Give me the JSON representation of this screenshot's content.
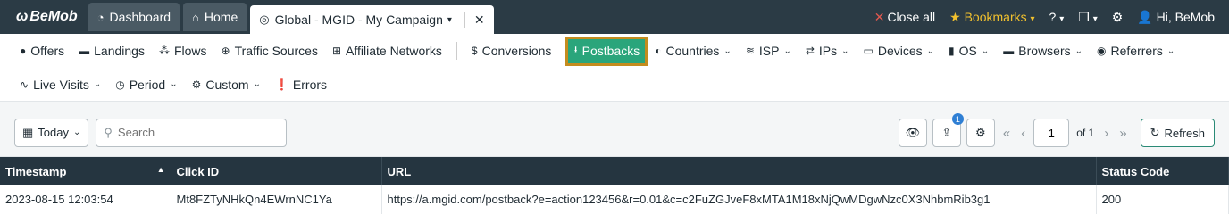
{
  "topbar": {
    "logo": "BeMob",
    "tabs": [
      {
        "label": "Dashboard",
        "icon": "dashboard-icon"
      },
      {
        "label": "Home",
        "icon": "home-icon"
      },
      {
        "label": "Global - MGID - My Campaign",
        "icon": "globe-icon",
        "active": true
      }
    ],
    "close_all": "Close all",
    "bookmarks": "Bookmarks",
    "user": "Hi, BeMob"
  },
  "nav": {
    "row1": [
      {
        "label": "Offers",
        "icon": "dollar-circle-icon"
      },
      {
        "label": "Landings",
        "icon": "window-icon"
      },
      {
        "label": "Flows",
        "icon": "sitemap-icon"
      },
      {
        "label": "Traffic Sources",
        "icon": "globe-icon"
      },
      {
        "label": "Affiliate Networks",
        "icon": "network-icon"
      },
      {
        "label": "Conversions",
        "icon": "dollar-icon"
      },
      {
        "label": "Postbacks",
        "icon": "download-icon",
        "highlighted": true
      },
      {
        "label": "Countries",
        "icon": "globe-icon",
        "dropdown": true
      },
      {
        "label": "ISP",
        "icon": "wifi-icon",
        "dropdown": true
      },
      {
        "label": "IPs",
        "icon": "exchange-icon",
        "dropdown": true
      },
      {
        "label": "Devices",
        "icon": "laptop-icon",
        "dropdown": true
      },
      {
        "label": "OS",
        "icon": "mobile-icon",
        "dropdown": true
      },
      {
        "label": "Browsers",
        "icon": "browser-icon",
        "dropdown": true
      },
      {
        "label": "Referrers",
        "icon": "compass-icon",
        "dropdown": true
      }
    ],
    "row2": [
      {
        "label": "Live Visits",
        "icon": "pulse-icon",
        "dropdown": true
      },
      {
        "label": "Period",
        "icon": "clock-icon",
        "dropdown": true
      },
      {
        "label": "Custom",
        "icon": "cogs-icon",
        "dropdown": true
      },
      {
        "label": "Errors",
        "icon": "alert-icon"
      }
    ]
  },
  "toolbar": {
    "date_range": "Today",
    "search_placeholder": "Search",
    "badge_count": "1",
    "page": "1",
    "of_pages": "of 1",
    "refresh": "Refresh"
  },
  "table": {
    "headers": [
      "Timestamp",
      "Click ID",
      "URL",
      "Status Code"
    ],
    "rows": [
      [
        "2023-08-15 12:03:54",
        "Mt8FZTyNHkQn4EWrnNC1Ya",
        "https://a.mgid.com/postback?e=action123456&r=0.01&c=c2FuZGJveF8xMTA1M18xNjQwMDgwNzc0X3NhbmRib3g1",
        "200"
      ]
    ]
  }
}
